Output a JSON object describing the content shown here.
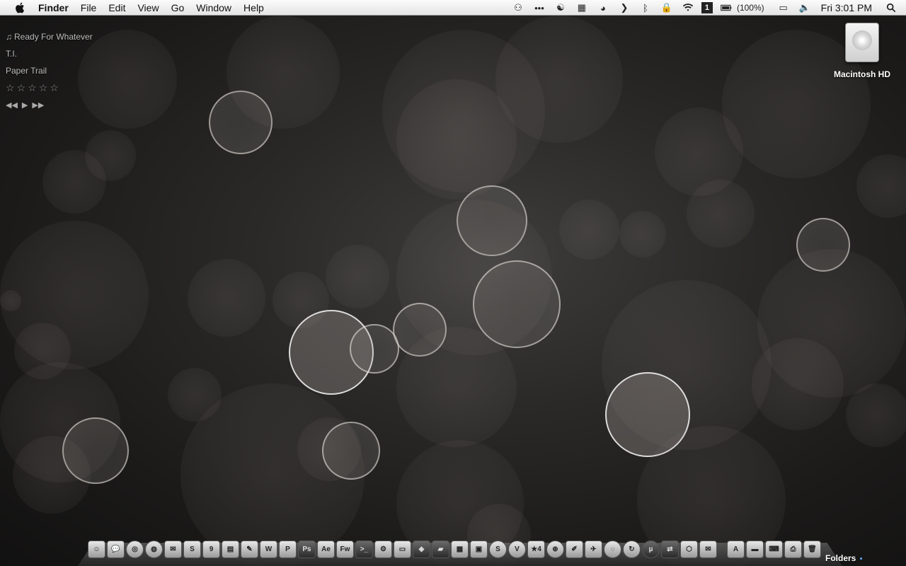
{
  "menubar": {
    "app_name": "Finder",
    "items": [
      "File",
      "Edit",
      "View",
      "Go",
      "Window",
      "Help"
    ],
    "status_icons": [
      "growl-icon",
      "dots-icon",
      "yinyang-icon",
      "spaces-icon",
      "pie-icon",
      "chevron-icon",
      "bluetooth-icon",
      "lock-icon",
      "wifi-icon",
      "one-icon",
      "battery-icon"
    ],
    "battery_text": "(100%)",
    "clock": "Fri 3:01 PM"
  },
  "now_playing": {
    "track": "Ready For Whatever",
    "artist": "T.I.",
    "album": "Paper Trail",
    "rating": 0,
    "controls": [
      "previous-icon",
      "play-icon",
      "next-icon"
    ]
  },
  "desktop": {
    "drive_label": "Macintosh HD"
  },
  "dock": {
    "apps": [
      {
        "name": "finder-icon",
        "glyph": "☺"
      },
      {
        "name": "ichat-icon",
        "glyph": "💬"
      },
      {
        "name": "safari-icon",
        "glyph": "◎"
      },
      {
        "name": "firefox-icon",
        "glyph": "◍"
      },
      {
        "name": "mail-icon",
        "glyph": "✉"
      },
      {
        "name": "skype-alt-icon",
        "glyph": "S"
      },
      {
        "name": "ical-icon",
        "glyph": "9"
      },
      {
        "name": "notepad-icon",
        "glyph": "▤"
      },
      {
        "name": "brush-icon",
        "glyph": "✎"
      },
      {
        "name": "word-icon",
        "glyph": "W"
      },
      {
        "name": "powerpoint-icon",
        "glyph": "P"
      },
      {
        "name": "photoshop-icon",
        "glyph": "Ps"
      },
      {
        "name": "aftereffects-icon",
        "glyph": "Ae"
      },
      {
        "name": "fireworks-icon",
        "glyph": "Fw"
      },
      {
        "name": "terminal-icon",
        "glyph": ">_"
      },
      {
        "name": "gear-icon",
        "glyph": "⚙"
      },
      {
        "name": "drive-icon",
        "glyph": "▭"
      },
      {
        "name": "gamepad-icon",
        "glyph": "◈"
      },
      {
        "name": "tablet-icon",
        "glyph": "▰"
      },
      {
        "name": "clipboard-icon",
        "glyph": "▦"
      },
      {
        "name": "preview-icon",
        "glyph": "▣"
      },
      {
        "name": "skype-icon",
        "glyph": "S"
      },
      {
        "name": "vlc-icon",
        "glyph": "V"
      },
      {
        "name": "star4-icon",
        "glyph": "★4"
      },
      {
        "name": "globe-icon",
        "glyph": "⊕"
      },
      {
        "name": "pencil-icon",
        "glyph": "✐"
      },
      {
        "name": "mailplane-icon",
        "glyph": "✈"
      },
      {
        "name": "speech-icon",
        "glyph": "◌"
      },
      {
        "name": "sync-icon",
        "glyph": "↻"
      },
      {
        "name": "utorrent-icon",
        "glyph": "µ"
      },
      {
        "name": "transmit-icon",
        "glyph": "⇄"
      },
      {
        "name": "network-icon",
        "glyph": "⬡"
      },
      {
        "name": "stamp-icon",
        "glyph": "✉"
      },
      {
        "name": "appstore-icon",
        "glyph": "A"
      },
      {
        "name": "truck-icon",
        "glyph": "▬"
      },
      {
        "name": "keyboard-icon",
        "glyph": "⌨"
      },
      {
        "name": "printer-icon",
        "glyph": "⎙"
      },
      {
        "name": "trash-icon",
        "glyph": "🗑"
      }
    ],
    "folders_label": "Folders"
  }
}
